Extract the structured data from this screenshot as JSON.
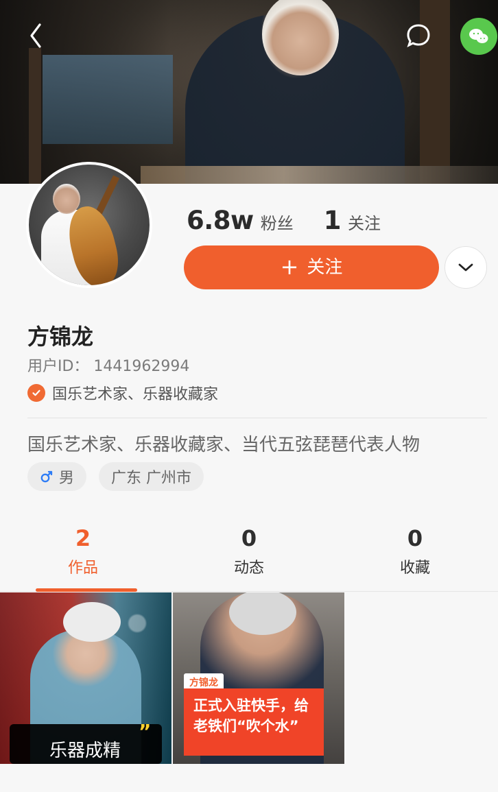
{
  "header": {
    "back_label": "",
    "chat_label": "",
    "wechat_label": ""
  },
  "profile": {
    "stats": {
      "fans_count": "6.8w",
      "fans_label": "粉丝",
      "following_count": "1",
      "following_label": "关注"
    },
    "follow_button": {
      "icon": "+",
      "label": "关注"
    },
    "name": "方锦龙",
    "user_id": "用户ID： 1441962994",
    "verification": "国乐艺术家、乐器收藏家",
    "bio": "国乐艺术家、乐器收藏家、当代五弦琵琶代表人物",
    "tags": {
      "gender_label": "男",
      "location": "广东 广州市"
    }
  },
  "tabs": [
    {
      "count": "2",
      "label": "作品"
    },
    {
      "count": "0",
      "label": "动态"
    },
    {
      "count": "0",
      "label": "收藏"
    }
  ],
  "works": [
    {
      "caption": "乐器成精"
    },
    {
      "badge": "方锦龙",
      "caption": "正式入驻快手，给老铁们“吹个水”"
    }
  ],
  "colors": {
    "accent": "#f05f2d",
    "wechat": "#59c84d",
    "background": "#f7f7f7"
  },
  "icons": {
    "back": "back-arrow-icon",
    "chat": "chat-bubble-icon",
    "wechat": "wechat-icon",
    "verify": "verified-check-icon",
    "gender": "male-icon",
    "more": "chevron-down-icon"
  }
}
